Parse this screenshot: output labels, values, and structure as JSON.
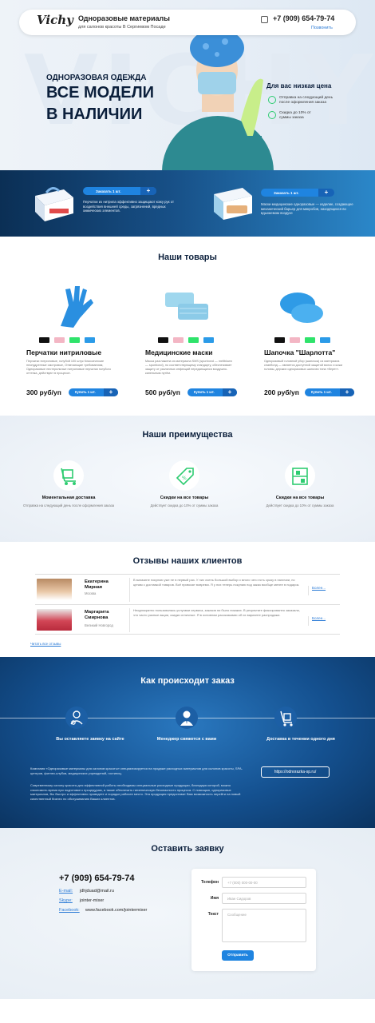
{
  "header": {
    "logo": "Vichy",
    "title": "Одноразовые материалы",
    "subtitle": "для салонов красоты В Сергиевом Посаде",
    "phone": "+7 (909) 654-79-74",
    "call_link": "Позвонить"
  },
  "hero": {
    "watermark": "VICHY",
    "line1": "ОДНОРАЗОВАЯ ОДЕЖДА",
    "line2": "ВСЕ МОДЕЛИ",
    "line3": "В НАЛИЧИИ",
    "low_price_title": "Для вас низкая цена",
    "benefits": [
      "Отправка на следующий день после оформления заказа",
      "Скидка до 10% от суммы заказа"
    ]
  },
  "promo": [
    {
      "button": "Заказать 1 шт.",
      "text": "Перчатки из нитрила эффективно защищают кожу рук от воздействия внешней среды, загрязнений, вредных химических элементов."
    },
    {
      "button": "Заказать 1 шт.",
      "text": "Маски медицинские одноразовые — изделие, создающее механический барьер для микробов, находящихся во вдыхаемом воздухе"
    }
  ],
  "products_section": {
    "title": "Наши товары",
    "items": [
      {
        "name": "Перчатки нитриловые",
        "desc": "Перчатки нитриловые, голубой 100 штук Классические неопудренные смотровые, Отвечающие требованиям, Одноразовые нестерильные нитриловые перчатки голубого оттенка, действуют в процессе.",
        "price": "300 руб/уп",
        "button": "Купить 1 шт."
      },
      {
        "name": "Медицинские маски",
        "desc": "Маска разглажена из материала SMS (spunbond — meltblown — spunbond), по соответствующему стандарту, обеспечивает защиту от различных инфекций передающихся воздушно-капельным путём.",
        "price": "500 руб/уп",
        "button": "Купить 1 шт."
      },
      {
        "name": "Шапочка \"Шарлотта\"",
        "desc": "Одноразовый головной убор (шапочка) из материала спанбонд — является доступной защитой волос и кожи головы, дерзких одноразовых шапочек типа «берет».",
        "price": "200 руб/уп",
        "button": "Купить 1 шт."
      }
    ],
    "swatches": [
      "#111111",
      "#f3b6c4",
      "#2fe36b",
      "#2b9be8"
    ]
  },
  "advantages": {
    "title": "Наши преимущества",
    "items": [
      {
        "title": "Моментальная доставка",
        "sub": "Отправка на следующий день после оформления заказа",
        "icon": "cart-icon"
      },
      {
        "title": "Скидки на все товары",
        "sub": "Действует скидка до 10% от суммы заказа",
        "icon": "price-tag-icon"
      },
      {
        "title": "Скидки на все товары",
        "sub": "Действует скидка до 10% от суммы заказа",
        "icon": "warehouse-icon"
      }
    ]
  },
  "reviews": {
    "title": "Отзывы наших клиентов",
    "items": [
      {
        "name": "Екатерина Мирная",
        "city": "Москва",
        "text": "В магазине покупаю уже не в первый раз. У них очень большой выбор и много чего есть сразу в наличии, по ценам с доставкой товаров. Всё привозят вовремя. Я у них теперь покупаю под заказ вообще менее в подарок.",
        "more": "Более..."
      },
      {
        "name": "Маргарита Смирнова",
        "city": "Великий Новгород",
        "text": "Неоднократно пользовалась услугами сервиса, заказов ни было никаких. В результате фиксированно заказала, что часто разные акции, скидки отличные. Я в основном рассказываю об их варианте распродажи.",
        "more": "Более..."
      }
    ],
    "all_link": "Читать все отзывы"
  },
  "how": {
    "title": "Как происходит заказ",
    "steps": [
      {
        "text": "Вы оставляете заявку на сайте",
        "icon": "doctor-icon"
      },
      {
        "text": "Менеджер свяжется с вами",
        "icon": "manager-icon"
      },
      {
        "text": "Доставка в течении одного дня",
        "icon": "delivery-cart-icon"
      }
    ],
    "para1": "Компания «Одноразовые материалы для салонов красоты» специализируется на продаже расходных материалов для салонов красоты, SPA-центров, фитнес-клубов, медицинских учреждений, гостиниц.",
    "para2": "Современному салону красоты для эффективной работы необходимы специальные расходные продукции, благодаря которой, можно сэкономить время при подготовке к процедурам, а также обеспечить гигиеническую безопасность процесса. С помощью, одноразовых материалов, Вы быстро и эффективно проведете и порядке рабочее место. Эта продукция предоставит Вам возможность перейти на новый качественный бизнес по обслуживанию Ваших клиентов.",
    "site_button": "https://odnorazka-sp.ru/"
  },
  "contact": {
    "title": "Оставить заявку",
    "phone": "+7 (909) 654-79-74",
    "email_label": "E-mail:",
    "email": "jdhjduad@mail.ru",
    "skype_label": "Skype:",
    "skype": "jointer-mixer",
    "facebook_label": "Facebook:",
    "facebook": "www.facebook.com/jointermixer",
    "form": {
      "phone_label": "Телефон",
      "phone_placeholder": "+7 (000) 000-00-00",
      "name_label": "Имя",
      "name_placeholder": "Иван Сидоров",
      "text_label": "Текст",
      "text_placeholder": "Сообщение",
      "submit": "Отправить"
    }
  }
}
